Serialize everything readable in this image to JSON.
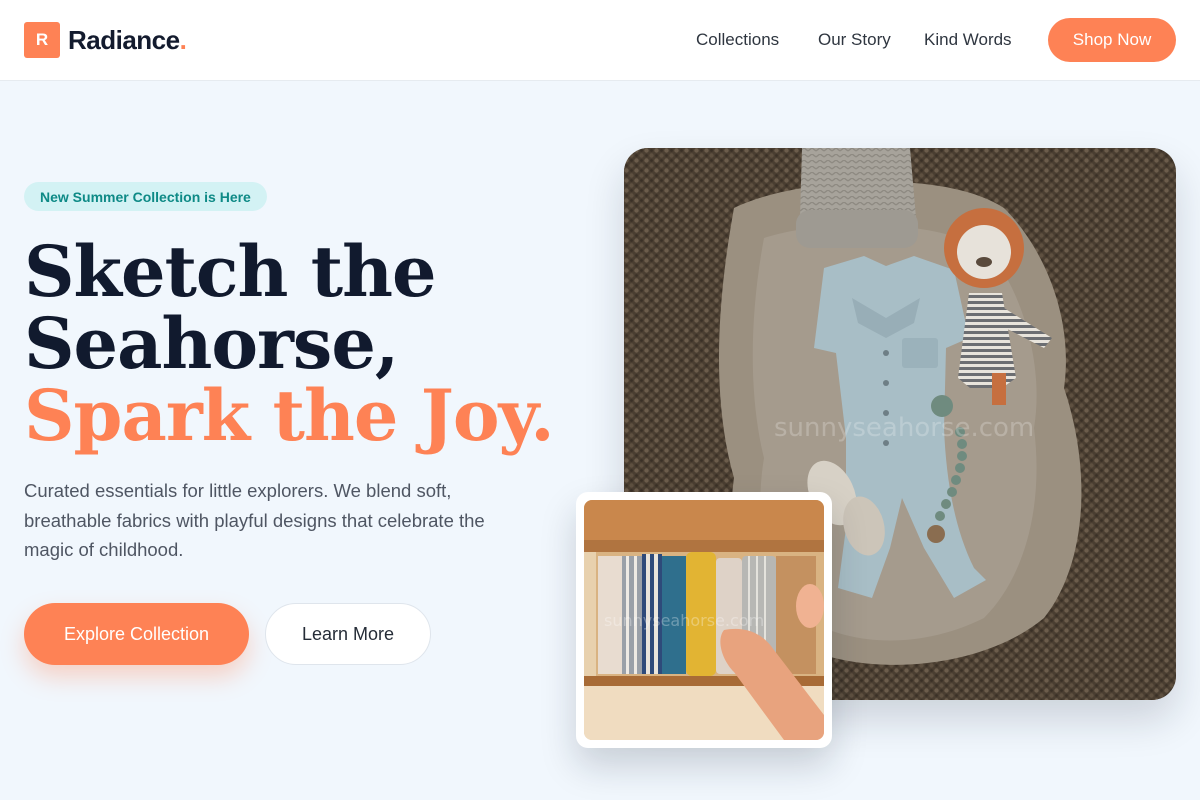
{
  "brand": {
    "mark": "R",
    "name": "Radiance",
    "dot": ".",
    "accent_color": "#fe8255"
  },
  "nav": {
    "items": [
      "Collections",
      "Our Story",
      "Kind Words"
    ],
    "cta": "Shop Now"
  },
  "hero": {
    "badge": "New Summer Collection is Here",
    "headline_line1": "Sketch the",
    "headline_line2": "Seahorse,",
    "headline_line3": "Spark the Joy.",
    "description": "Curated essentials for little explorers. We blend soft, breathable fabrics with playful designs that celebrate the magic of childhood.",
    "primary_button": "Explore Collection",
    "secondary_button": "Learn More"
  },
  "images": {
    "main_watermark": "sunnyseahorse.com",
    "small_watermark": "sunnyseahorse.com"
  },
  "colors": {
    "heading": "#111a2e",
    "badge_bg": "#d3f2f4",
    "badge_text": "#0e8a86",
    "page_bg": "#f1f7fd"
  }
}
